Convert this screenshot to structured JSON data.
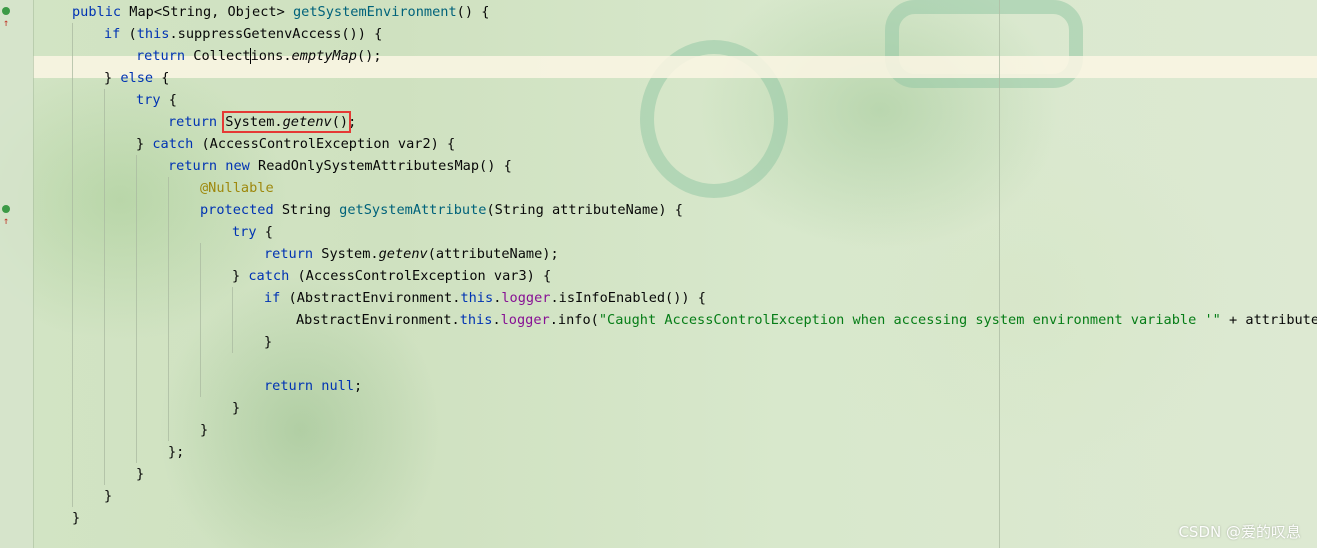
{
  "editor": {
    "lines": [
      {
        "indent": 1,
        "parts": [
          {
            "t": "public",
            "c": "kw"
          },
          {
            "t": " Map<String, Object> "
          },
          {
            "t": "getSystemEnvironment",
            "c": "fn"
          },
          {
            "t": "() {"
          }
        ]
      },
      {
        "indent": 2,
        "parts": [
          {
            "t": "if",
            "c": "kw"
          },
          {
            "t": " ("
          },
          {
            "t": "this",
            "c": "kw"
          },
          {
            "t": ".suppressGetenvAccess()) {"
          }
        ]
      },
      {
        "indent": 3,
        "parts": [
          {
            "t": "return",
            "c": "kw"
          },
          {
            "t": " Collect"
          },
          {
            "caret": true
          },
          {
            "t": "ions."
          },
          {
            "t": "emptyMap",
            "c": "it"
          },
          {
            "t": "();"
          }
        ]
      },
      {
        "indent": 2,
        "parts": [
          {
            "t": "} "
          },
          {
            "t": "else",
            "c": "kw"
          },
          {
            "t": " {"
          }
        ]
      },
      {
        "indent": 3,
        "parts": [
          {
            "t": "try",
            "c": "kw"
          },
          {
            "t": " {"
          }
        ]
      },
      {
        "indent": 4,
        "parts": [
          {
            "t": "return",
            "c": "kw"
          },
          {
            "t": " "
          },
          {
            "t": "System.",
            "hl": true,
            "hlgroup": "start"
          },
          {
            "t": "getenv",
            "c": "it",
            "hl": true
          },
          {
            "t": "()",
            "hl": true,
            "hlgroup": "end"
          },
          {
            "t": ";"
          }
        ]
      },
      {
        "indent": 3,
        "parts": [
          {
            "t": "} "
          },
          {
            "t": "catch",
            "c": "kw"
          },
          {
            "t": " (AccessControlException var2) {"
          }
        ]
      },
      {
        "indent": 4,
        "parts": [
          {
            "t": "return",
            "c": "kw"
          },
          {
            "t": " "
          },
          {
            "t": "new",
            "c": "kw"
          },
          {
            "t": " ReadOnlySystemAttributesMap() {"
          }
        ]
      },
      {
        "indent": 5,
        "parts": [
          {
            "t": "@Nullable",
            "c": "ann"
          }
        ]
      },
      {
        "indent": 5,
        "parts": [
          {
            "t": "protected",
            "c": "kw"
          },
          {
            "t": " String "
          },
          {
            "t": "getSystemAttribute",
            "c": "fn"
          },
          {
            "t": "(String attributeName) {"
          }
        ]
      },
      {
        "indent": 6,
        "parts": [
          {
            "t": "try",
            "c": "kw"
          },
          {
            "t": " {"
          }
        ]
      },
      {
        "indent": 7,
        "parts": [
          {
            "t": "return",
            "c": "kw"
          },
          {
            "t": " System."
          },
          {
            "t": "getenv",
            "c": "it"
          },
          {
            "t": "(attributeName);"
          }
        ]
      },
      {
        "indent": 6,
        "parts": [
          {
            "t": "} "
          },
          {
            "t": "catch",
            "c": "kw"
          },
          {
            "t": " (AccessControlException var3) {"
          }
        ]
      },
      {
        "indent": 7,
        "parts": [
          {
            "t": "if",
            "c": "kw"
          },
          {
            "t": " (AbstractEnvironment."
          },
          {
            "t": "this",
            "c": "kw"
          },
          {
            "t": "."
          },
          {
            "t": "logger",
            "c": "fld"
          },
          {
            "t": ".isInfoEnabled()) {"
          }
        ]
      },
      {
        "indent": 8,
        "parts": [
          {
            "t": "AbstractEnvironment."
          },
          {
            "t": "this",
            "c": "kw"
          },
          {
            "t": "."
          },
          {
            "t": "logger",
            "c": "fld"
          },
          {
            "t": ".info("
          },
          {
            "t": "\"Caught AccessControlException when accessing system environment variable '\"",
            "c": "str"
          },
          {
            "t": " + attributeNam"
          }
        ]
      },
      {
        "indent": 7,
        "parts": [
          {
            "t": "}"
          }
        ]
      },
      {
        "indent": 0,
        "parts": []
      },
      {
        "indent": 7,
        "parts": [
          {
            "t": "return",
            "c": "kw"
          },
          {
            "t": " "
          },
          {
            "t": "null",
            "c": "kw"
          },
          {
            "t": ";"
          }
        ]
      },
      {
        "indent": 6,
        "parts": [
          {
            "t": "}"
          }
        ]
      },
      {
        "indent": 5,
        "parts": [
          {
            "t": "}"
          }
        ]
      },
      {
        "indent": 4,
        "parts": [
          {
            "t": "};"
          }
        ]
      },
      {
        "indent": 3,
        "parts": [
          {
            "t": "}"
          }
        ]
      },
      {
        "indent": 2,
        "parts": [
          {
            "t": "}"
          }
        ]
      },
      {
        "indent": 1,
        "parts": [
          {
            "t": "}"
          }
        ]
      }
    ],
    "gutter_markers": [
      {
        "line": 0,
        "icon": "override-method-icon"
      },
      {
        "line": 9,
        "icon": "override-method-icon"
      }
    ],
    "highlight_box": "System.getenv()"
  },
  "watermark": "CSDN @爱的叹息",
  "colors": {
    "keyword": "#0033b3",
    "method": "#00627a",
    "field": "#871094",
    "string": "#067d17",
    "annotation": "#9e880d",
    "highlight_border": "#e53935"
  }
}
